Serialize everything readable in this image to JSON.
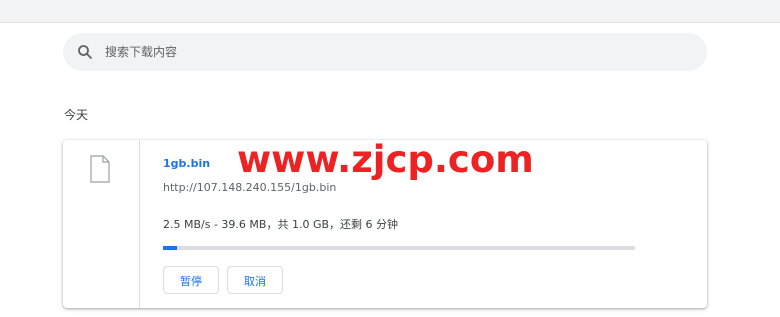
{
  "search": {
    "placeholder": "搜索下载内容"
  },
  "section": {
    "title": "今天"
  },
  "download": {
    "file_name": "1gb.bin",
    "url": "http://107.148.240.155/1gb.bin",
    "status": "2.5 MB/s - 39.6 MB，共 1.0 GB，还剩 6 分钟",
    "progress": 0.03,
    "pause_label": "暂停",
    "cancel_label": "取消"
  },
  "watermark": "www.zjcp.com",
  "colors": {
    "accent": "#1a73e8",
    "watermark": "#ee2222"
  },
  "icons": {
    "search": "search-icon",
    "file": "file-icon"
  }
}
